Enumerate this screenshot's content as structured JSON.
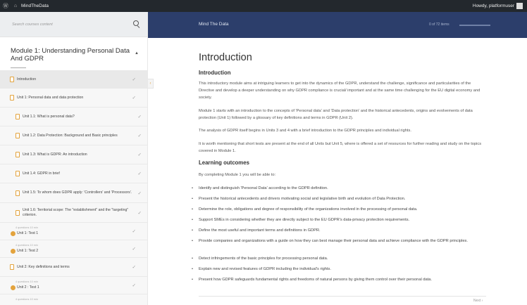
{
  "admin_bar": {
    "site_name": "MindTheData",
    "greeting": "Howdy, platformuser"
  },
  "sidebar": {
    "search_placeholder": "Search courses content",
    "module_title": "Module 1: Understanding Personal Data And GDPR",
    "items": [
      {
        "label": "Introduction",
        "type": "lesson",
        "level": 0,
        "active": true
      },
      {
        "label": "Unit 1: Personal data and data protection",
        "type": "lesson",
        "level": 0
      },
      {
        "label": "Unit 1.1: What is personal data?",
        "type": "lesson",
        "level": 1
      },
      {
        "label": "Unit 1.2: Data Protection: Background and Basic principles",
        "type": "lesson",
        "level": 1
      },
      {
        "label": "Unit 1.3: What is GDPR: An introduction",
        "type": "lesson",
        "level": 1
      },
      {
        "label": "Unit 1.4: GDPR in brief",
        "type": "lesson",
        "level": 1
      },
      {
        "label": "Unit 1.5: To whom does GDPR apply: 'Controllers' and 'Processors'.",
        "type": "lesson",
        "level": 1
      },
      {
        "label": "Unit 1.6: Territorial scope: The \"establishment\" and the \"targeting\" criterion.",
        "type": "lesson",
        "level": 1
      },
      {
        "label": "Unit 1: Test 1",
        "type": "quiz",
        "meta": "4 questions  10 min"
      },
      {
        "label": "Unit 1: Test 2",
        "type": "quiz",
        "meta": "4 questions  10 min"
      },
      {
        "label": "Unit 2: Key definitions and terms",
        "type": "lesson",
        "level": 0
      },
      {
        "label": "Unit 2 : Test 1",
        "type": "quiz",
        "meta": "4 questions  10 min"
      },
      {
        "label": "",
        "type": "quiz",
        "meta": "4 questions  10 min"
      }
    ]
  },
  "header": {
    "course_title": "Mind The Data",
    "progress_text": "0 of 72 items",
    "progress_fraction": 0.0
  },
  "content": {
    "page_title": "Introduction",
    "section_heading": "Introduction",
    "paragraphs": [
      "This introductory module aims at intriguing learners to get into the dynamics of the GDPR, understand the challenge, significance and particularities of the Directive and develop a deeper understanding on why GDPR compliance is crucial/ important and at the same time challenging for the EU digital economy and society.",
      "Module 1 starts with an introduction to the concepts of 'Personal data' and 'Data protection' and the historical antecedents, origins and evolvements of data protection (Unit 1) followed by a glossary of key definitions and terms in GDPR (Unit 2).",
      "The analysis of GDPR itself begins in Units 3 and 4 with a brief introduction to the GDPR principles and individual rights.",
      "It is worth mentioning that short tests are present at the end of all Units but Unit 5, where is offered a set of resources for further reading and study on the topics covered in Module 1."
    ],
    "outcomes_heading": "Learning outcomes",
    "outcomes_intro": "By completing Module 1 you will be able to:",
    "outcomes": [
      "Identify and distinguish 'Personal Data' according to the GDPR definition.",
      "Present the historical antecedents and drivers motivating social and legislative birth and evolution of Data Protection.",
      "Determine the role, obligations and degree of responsibility of the organizations involved in the processing of personal data.",
      "Support SMEs in considering whether they are directly subject to the EU GDPR's data-privacy protection requirements.",
      "Define the most useful and important terms and definitions in GDPR.",
      "Provide companies and organizations with a guide on how they can best manage their personal data and achieve compliance with the GDPR principles.",
      "Detect infringements of the basic principles for processing personal data.",
      "Explain new and revised features of GDPR including the individual's rights.",
      "Present how GDPR safeguards fundamental rights and freedoms of natural persons by giving them control over their personal data."
    ],
    "next_label": "Next ›"
  }
}
